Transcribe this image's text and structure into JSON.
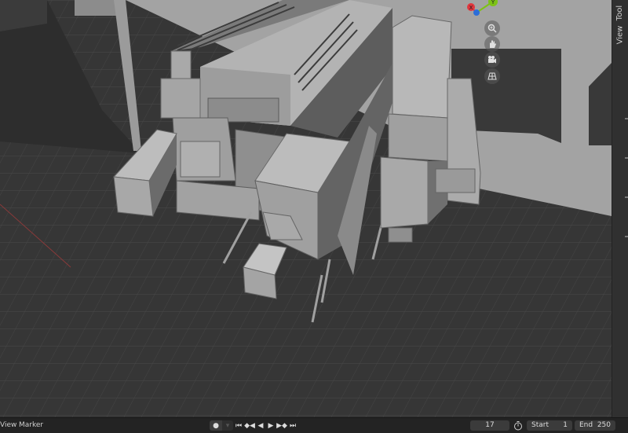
{
  "viewport": {
    "scene_description_icon": "3d-model"
  },
  "sidebar": {
    "tabs": [
      {
        "label": "Tool"
      },
      {
        "label": "View"
      }
    ]
  },
  "gizmo": {
    "axes": [
      {
        "label": "X",
        "color": "#e0363d"
      },
      {
        "label": "Y",
        "color": "#7dc215"
      },
      {
        "label": "Z",
        "color": "#2c6ed8"
      }
    ],
    "buttons": [
      "zoom-icon",
      "hand-icon",
      "camera-icon",
      "perspective-grid-icon"
    ]
  },
  "timeline": {
    "menu": {
      "view": "View",
      "marker": "Marker"
    },
    "playback": {
      "record": "●",
      "jump_start": "⏮",
      "prev_keyframe": "◆◀",
      "play_reverse": "◀",
      "play": "▶",
      "next_keyframe": "▶◆",
      "jump_end": "⏭"
    },
    "current_frame": "17",
    "start_label": "Start",
    "start_value": "1",
    "end_label": "End",
    "end_value": "250"
  },
  "colors": {
    "floor": "#373737",
    "grid": "#4a4a4a",
    "model": "#a5a5a5",
    "panel": "#232323"
  }
}
